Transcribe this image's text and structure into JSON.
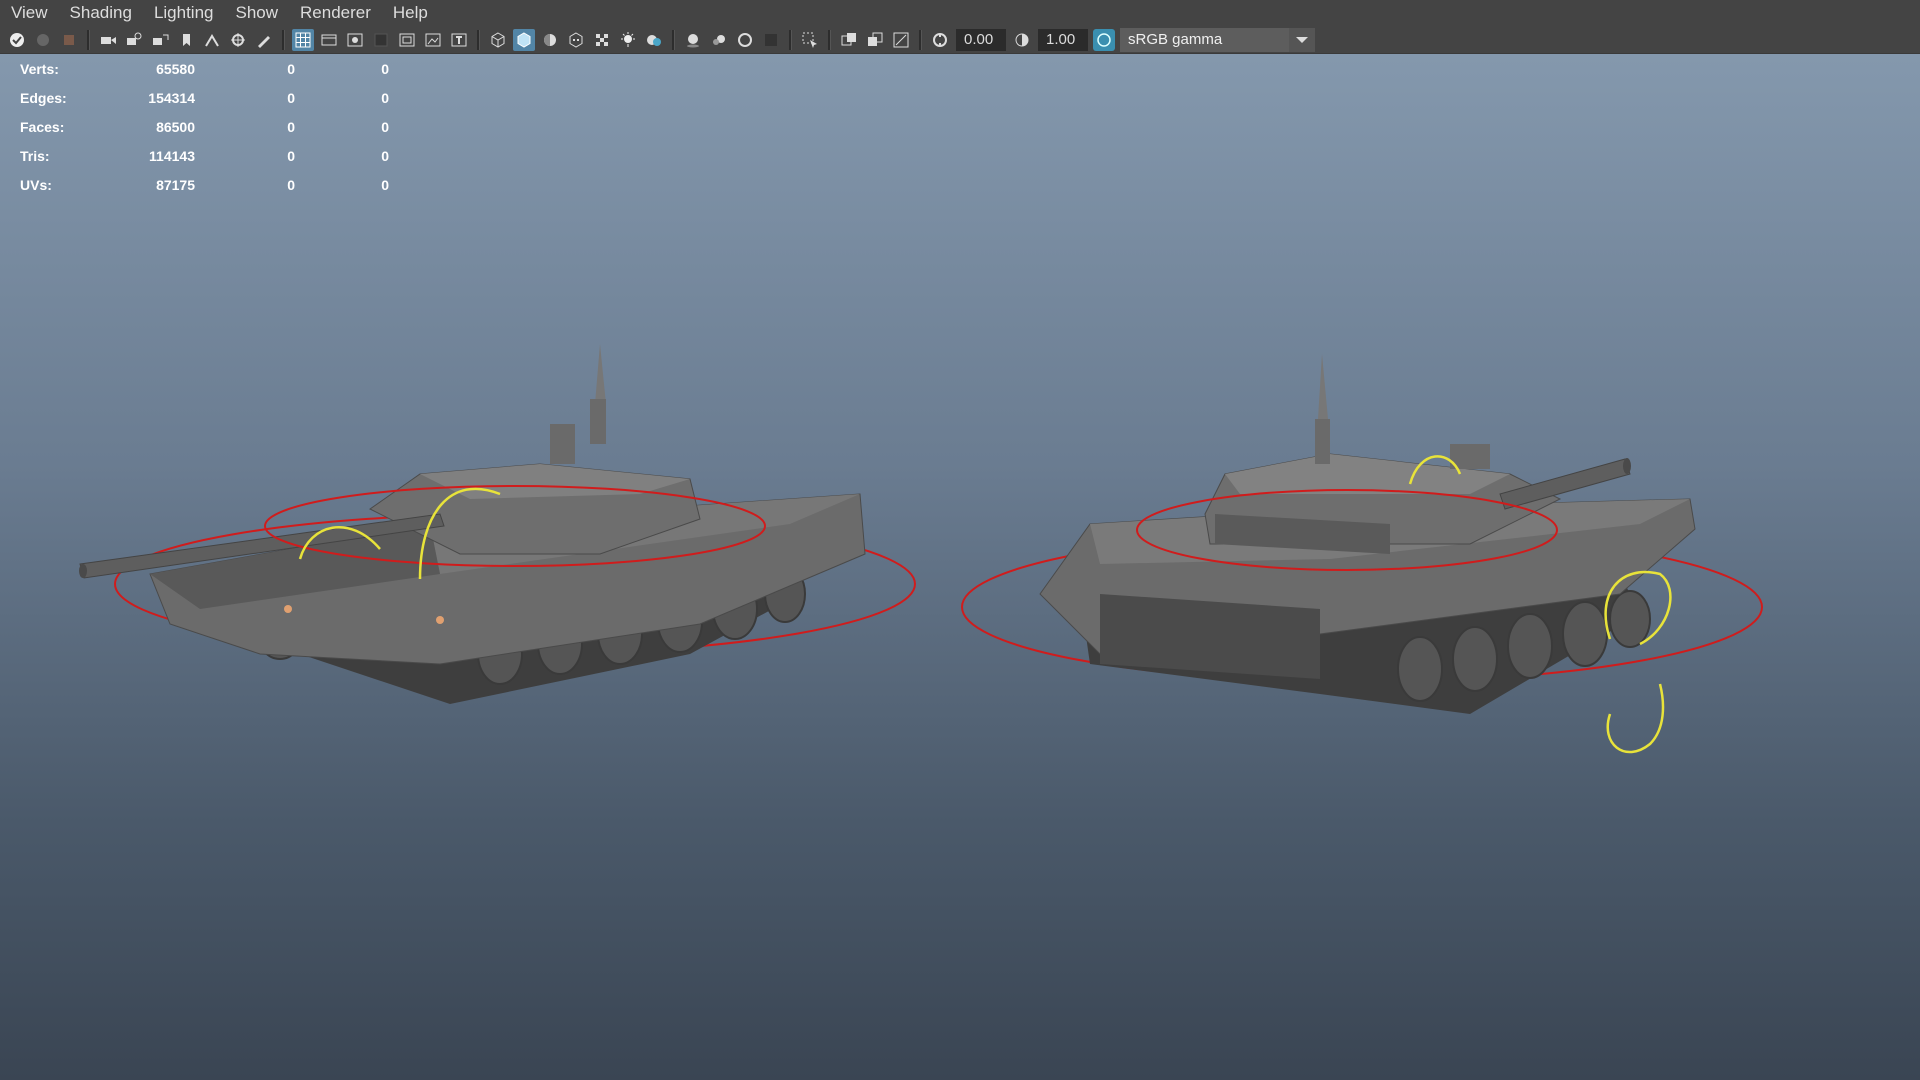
{
  "menu": [
    "View",
    "Shading",
    "Lighting",
    "Show",
    "Renderer",
    "Help"
  ],
  "toolbar": {
    "exposure": "0.00",
    "gamma": "1.00",
    "color_space": "sRGB gamma",
    "icons": [
      "select-camera-icon",
      "camera-attributes-icon",
      "bookmark-icon",
      "image-plane-icon",
      "grid-icon",
      "film-gate-icon",
      "resolution-gate-icon",
      "gate-mask-icon",
      "field-chart-icon",
      "safe-action-icon",
      "safe-title-icon",
      "wireframe-icon",
      "smooth-shade-icon",
      "default-material-icon",
      "textured-icon",
      "use-lights-icon",
      "shadows-icon",
      "screen-space-ao-icon",
      "motion-blur-icon",
      "anti-aliasing-icon",
      "depth-of-field-icon",
      "isolate-select-icon",
      "xray-icon",
      "xray-joints-icon",
      "xray-components-icon",
      "exposure-icon",
      "gamma-icon",
      "color-management-icon"
    ]
  },
  "hud": {
    "rows": [
      {
        "label": "Verts:",
        "total": "65580",
        "sel": "0",
        "sel2": "0"
      },
      {
        "label": "Edges:",
        "total": "154314",
        "sel": "0",
        "sel2": "0"
      },
      {
        "label": "Faces:",
        "total": "86500",
        "sel": "0",
        "sel2": "0"
      },
      {
        "label": "Tris:",
        "total": "114143",
        "sel": "0",
        "sel2": "0"
      },
      {
        "label": "UVs:",
        "total": "87175",
        "sel": "0",
        "sel2": "0"
      }
    ]
  },
  "colors": {
    "rig_circle": "#d01c1c",
    "rig_arc": "#e8e33a",
    "tank_body": "#6a6a6a",
    "tank_dark": "#4a4a4a"
  }
}
